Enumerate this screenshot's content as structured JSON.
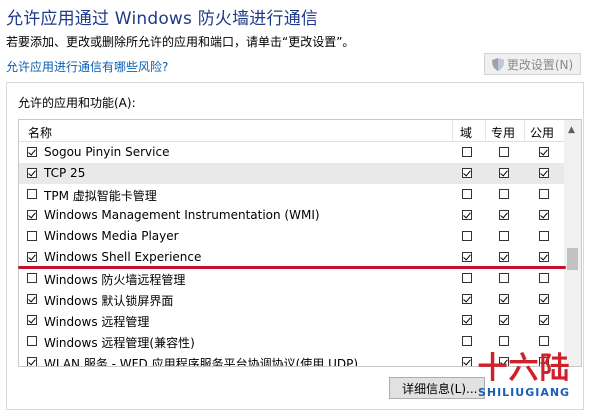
{
  "header": {
    "title": "允许应用通过 Windows 防火墙进行通信",
    "subtitle": "若要添加、更改或删除所允许的应用和端口，请单击“更改设置”。",
    "risk_link": "允许应用进行通信有哪些风险?",
    "change_settings_label": "更改设置(N)"
  },
  "panel": {
    "label": "允许的应用和功能(A):",
    "columns": {
      "name": "名称",
      "domain": "域",
      "private": "专用",
      "public": "公用"
    },
    "rows": [
      {
        "name": "Sogou Pinyin Service",
        "enabled": true,
        "domain": false,
        "private": false,
        "public": true
      },
      {
        "name": "TCP 25",
        "enabled": true,
        "domain": true,
        "private": true,
        "public": true,
        "selected": true
      },
      {
        "name": "TPM 虚拟智能卡管理",
        "enabled": false,
        "domain": false,
        "private": false,
        "public": false
      },
      {
        "name": "Windows Management Instrumentation (WMI)",
        "enabled": true,
        "domain": true,
        "private": true,
        "public": true
      },
      {
        "name": "Windows Media Player",
        "enabled": false,
        "domain": false,
        "private": false,
        "public": false
      },
      {
        "name": "Windows Shell Experience",
        "enabled": true,
        "domain": true,
        "private": true,
        "public": true
      },
      {
        "name": "Windows 防火墙远程管理",
        "enabled": false,
        "domain": false,
        "private": false,
        "public": false
      },
      {
        "name": "Windows 默认锁屏界面",
        "enabled": true,
        "domain": true,
        "private": true,
        "public": true
      },
      {
        "name": "Windows 远程管理",
        "enabled": true,
        "domain": true,
        "private": true,
        "public": true
      },
      {
        "name": "Windows 远程管理(兼容性)",
        "enabled": false,
        "domain": false,
        "private": false,
        "public": false
      },
      {
        "name": "WLAN 服务 - WFD 应用程序服务平台协调协议(使用 UDP)",
        "enabled": true,
        "domain": true,
        "private": true,
        "public": true
      }
    ],
    "details_label": "详细信息(L)..."
  },
  "watermark": {
    "top": "十六陆",
    "bottom": "SHILIUGIANG"
  },
  "colors": {
    "title": "#1e3a8a",
    "link": "#0a5fb4",
    "annotation_line": "#c8102e",
    "watermark_red": "#d0202a",
    "watermark_blue": "#1a5fb4"
  }
}
